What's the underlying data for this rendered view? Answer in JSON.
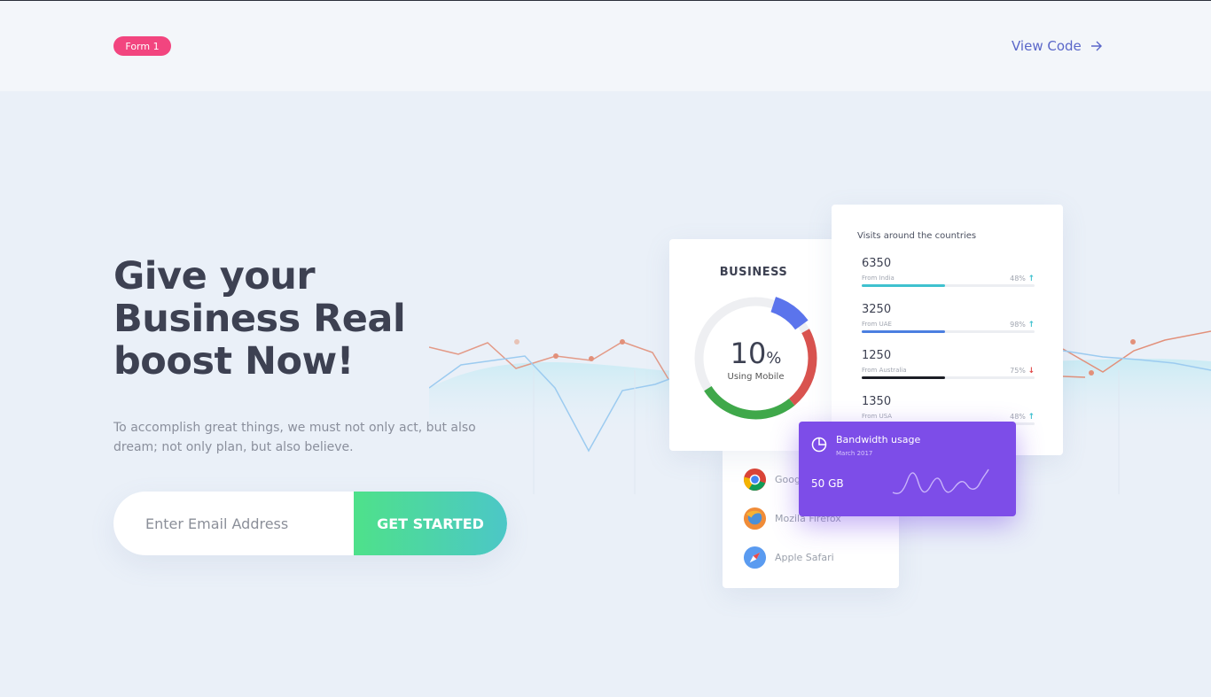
{
  "header": {
    "badge_label": "Form 1",
    "view_code_label": "View Code",
    "view_code_icon": "arrow-right-icon"
  },
  "hero": {
    "headline": "Give your Business Real boost Now!",
    "subtext": "To accomplish great things, we must not only act, but also dream; not only plan, but also believe.",
    "email_placeholder": "Enter Email Address",
    "cta_label": "GET STARTED"
  },
  "business_card": {
    "title": "BUSINESS",
    "value": "10",
    "unit": "%",
    "label": "Using Mobile"
  },
  "browsers": [
    {
      "name": "Google Chrome",
      "icon": "chrome-icon"
    },
    {
      "name": "Mozila Firefox",
      "icon": "firefox-icon"
    },
    {
      "name": "Apple Safari",
      "icon": "safari-icon"
    }
  ],
  "visits": {
    "title": "Visits around the countries",
    "rows": [
      {
        "value": "6350",
        "from": "From India",
        "pct": "48%",
        "trend": "up",
        "fill": 0.48,
        "color": "#3fc1cf"
      },
      {
        "value": "3250",
        "from": "From UAE",
        "pct": "98%",
        "trend": "up",
        "fill": 0.48,
        "color": "#4b7fe0"
      },
      {
        "value": "1250",
        "from": "From Australia",
        "pct": "75%",
        "trend": "down",
        "fill": 0.48,
        "color": "#1b1d25"
      },
      {
        "value": "1350",
        "from": "From USA",
        "pct": "48%",
        "trend": "up",
        "fill": 0.48,
        "color": "#3fc1cf"
      }
    ]
  },
  "bandwidth": {
    "title": "Bandwidth usage",
    "date": "March 2017",
    "value": "50 GB",
    "icon": "pie-chart-icon"
  },
  "colors": {
    "badge": "#f2457f",
    "accent": "#5a67c9",
    "cta_start": "#4ee18a",
    "cta_end": "#4cc7c7",
    "bandwidth": "#7d4de8",
    "donut_blue": "#5b74ec",
    "donut_red": "#d9534f",
    "donut_green": "#3fa84a"
  }
}
